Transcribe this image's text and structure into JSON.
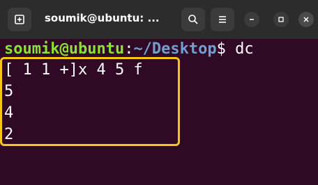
{
  "titlebar": {
    "title": "soumik@ubuntu: ...",
    "new_tab_icon": "new-tab-icon",
    "search_icon": "search-icon",
    "menu_icon": "hamburger-menu-icon",
    "minimize_icon": "minimize-icon",
    "maximize_icon": "maximize-icon",
    "close_icon": "close-icon"
  },
  "terminal": {
    "prompt_user": "soumik@ubuntu",
    "prompt_colon": ":",
    "prompt_path": "~/Desktop",
    "prompt_symbol": "$ ",
    "command": "dc",
    "output": [
      "[ 1 1 +]x 4 5 f",
      "5",
      "4",
      "2"
    ]
  },
  "colors": {
    "background": "#300a24",
    "titlebar": "#2c2c2c",
    "prompt_user": "#8ae234",
    "prompt_path": "#729fcf",
    "highlight": "#f5c518"
  }
}
